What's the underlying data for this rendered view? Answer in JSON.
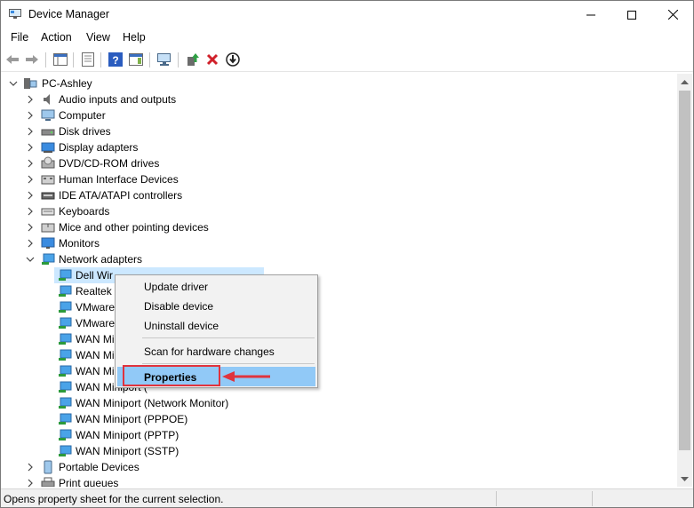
{
  "window": {
    "title": "Device Manager"
  },
  "menu": {
    "items": [
      "File",
      "Action",
      "View",
      "Help"
    ]
  },
  "toolbar": {
    "icons": [
      "back-icon",
      "forward-icon",
      "show-hide-console-tree-icon",
      "properties-icon",
      "help-icon",
      "action-pane-icon",
      "scan-hardware-icon",
      "update-driver-icon",
      "uninstall-icon",
      "install-icon"
    ]
  },
  "tree": {
    "root": "PC-Ashley",
    "categories": [
      "Audio inputs and outputs",
      "Computer",
      "Disk drives",
      "Display adapters",
      "DVD/CD-ROM drives",
      "Human Interface Devices",
      "IDE ATA/ATAPI controllers",
      "Keyboards",
      "Mice and other pointing devices",
      "Monitors",
      "Network adapters"
    ],
    "network_children": [
      "Dell Wir",
      "Realtek",
      "VMware",
      "VMware",
      "WAN Mi",
      "WAN Mi",
      "WAN Mi",
      "WAN Miniport (",
      "WAN Miniport (Network Monitor)",
      "WAN Miniport (PPPOE)",
      "WAN Miniport (PPTP)",
      "WAN Miniport (SSTP)"
    ],
    "after": [
      "Portable Devices",
      "Print queues"
    ]
  },
  "context_menu": {
    "items": [
      "Update driver",
      "Disable device",
      "Uninstall device",
      "Scan for hardware changes",
      "Properties"
    ]
  },
  "status": {
    "text": "Opens property sheet for the current selection."
  },
  "colors": {
    "selection": "#cce8ff",
    "menu_highlight": "#91c9f7",
    "annotation_red": "#e0333d"
  }
}
